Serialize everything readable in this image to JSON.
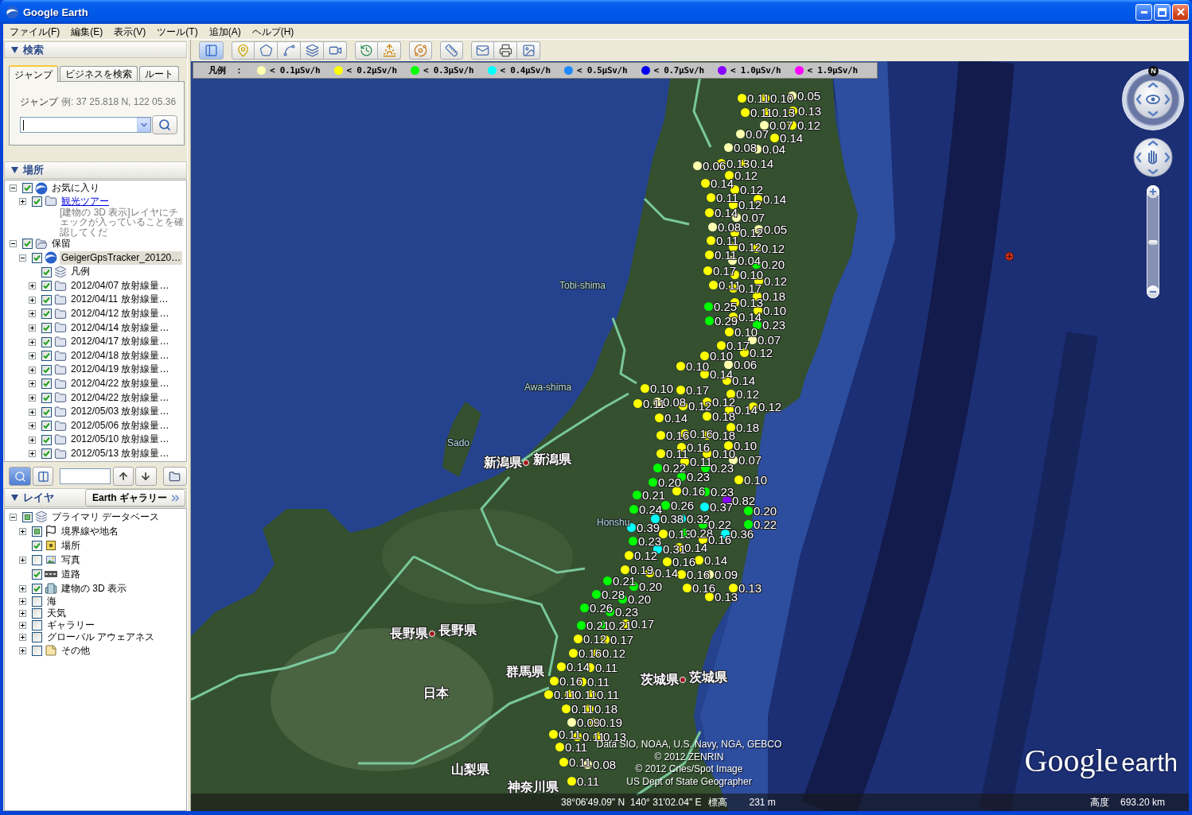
{
  "window": {
    "title": "Google Earth",
    "buttons": [
      {
        "kind": "minimize"
      },
      {
        "kind": "maximize"
      },
      {
        "kind": "close"
      }
    ]
  },
  "menu": [
    "ファイル(F)",
    "編集(E)",
    "表示(V)",
    "ツール(T)",
    "追加(A)",
    "ヘルプ(H)"
  ],
  "search": {
    "title": "検索",
    "expanded": true,
    "tabs": [
      {
        "label": "ジャンプ",
        "selected": true
      },
      {
        "label": "ビジネスを検索",
        "selected": false
      },
      {
        "label": "ルート",
        "selected": false
      }
    ],
    "hint_label": "ジャンプ",
    "hint_example": "例: 37 25.818 N, 122 05.36"
  },
  "places": {
    "title": "場所",
    "expanded": true,
    "items": [
      {
        "label": "お気に入り",
        "kind": "globe",
        "checked": true,
        "expanded": true,
        "selected": false,
        "children": [
          {
            "label": "観光ツアー",
            "kind": "folder",
            "checked": true,
            "expanded": false,
            "selected": false,
            "link": true,
            "description": "[建物の 3D 表示]レイヤにチェックが入っていることを確認してくだ"
          }
        ]
      },
      {
        "label": "保留",
        "kind": "folder-open",
        "checked": true,
        "expanded": true,
        "selected": false,
        "children": [
          {
            "label": "GeigerGpsTracker_20120…",
            "kind": "globe",
            "checked": true,
            "expanded": true,
            "selected": true,
            "children": [
              {
                "label": "凡例",
                "kind": "layers",
                "checked": true,
                "selected": false
              },
              {
                "label": "2012/04/07 放射線量…",
                "kind": "folder",
                "checked": true,
                "expanded": false,
                "selected": false
              },
              {
                "label": "2012/04/11 放射線量…",
                "kind": "folder",
                "checked": true,
                "expanded": false,
                "selected": false
              },
              {
                "label": "2012/04/12 放射線量…",
                "kind": "folder",
                "checked": true,
                "expanded": false,
                "selected": false
              },
              {
                "label": "2012/04/14 放射線量…",
                "kind": "folder",
                "checked": true,
                "expanded": false,
                "selected": false
              },
              {
                "label": "2012/04/17 放射線量…",
                "kind": "folder",
                "checked": true,
                "expanded": false,
                "selected": false
              },
              {
                "label": "2012/04/18 放射線量…",
                "kind": "folder",
                "checked": true,
                "expanded": false,
                "selected": false
              },
              {
                "label": "2012/04/19 放射線量…",
                "kind": "folder",
                "checked": true,
                "expanded": false,
                "selected": false
              },
              {
                "label": "2012/04/22 放射線量…",
                "kind": "folder",
                "checked": true,
                "expanded": false,
                "selected": false
              },
              {
                "label": "2012/04/22 放射線量…",
                "kind": "folder",
                "checked": true,
                "expanded": false,
                "selected": false
              },
              {
                "label": "2012/05/03 放射線量…",
                "kind": "folder",
                "checked": true,
                "expanded": false,
                "selected": false
              },
              {
                "label": "2012/05/06 放射線量…",
                "kind": "folder",
                "checked": true,
                "expanded": false,
                "selected": false
              },
              {
                "label": "2012/05/10 放射線量…",
                "kind": "folder",
                "checked": true,
                "expanded": false,
                "selected": false
              },
              {
                "label": "2012/05/13 放射線量…",
                "kind": "folder",
                "checked": true,
                "expanded": false,
                "selected": false
              }
            ]
          }
        ]
      }
    ]
  },
  "places_toolbar": [
    {
      "kind": "search",
      "selected": true
    },
    {
      "kind": "panel",
      "selected": false
    },
    {
      "kind": "field"
    },
    {
      "kind": "up"
    },
    {
      "kind": "down"
    },
    {
      "kind": "folder"
    }
  ],
  "layers": {
    "title": "レイヤ",
    "expanded": true,
    "gallery_button": "Earth ギャラリー",
    "items": [
      {
        "label": "プライマリ データベース",
        "kind": "layers",
        "checked": false,
        "mixed": true,
        "expanded": true,
        "children": [
          {
            "label": "境界線や地名",
            "kind": "flag",
            "checked": false,
            "mixed": true,
            "expanded": false
          },
          {
            "label": "場所",
            "kind": "place",
            "checked": true,
            "mixed": false
          },
          {
            "label": "写真",
            "kind": "photo",
            "checked": false,
            "mixed": false,
            "expanded": false
          },
          {
            "label": "道路",
            "kind": "road",
            "checked": true,
            "mixed": false
          },
          {
            "label": "建物の 3D 表示",
            "kind": "building",
            "checked": true,
            "mixed": false,
            "expanded": false
          },
          {
            "label": "海",
            "kind": "plain",
            "checked": false,
            "mixed": false,
            "expanded": false
          },
          {
            "label": "天気",
            "kind": "plain",
            "checked": false,
            "mixed": false,
            "expanded": false
          },
          {
            "label": "ギャラリー",
            "kind": "plain",
            "checked": false,
            "mixed": false,
            "expanded": false
          },
          {
            "label": "グローバル アウェアネス",
            "kind": "plain",
            "checked": false,
            "mixed": false,
            "expanded": false
          },
          {
            "label": "その他",
            "kind": "note",
            "checked": false,
            "mixed": false,
            "expanded": false
          }
        ]
      }
    ]
  },
  "toolbar": {
    "groups": [
      {
        "buttons": [
          {
            "kind": "sidebar",
            "selected": true
          }
        ]
      },
      {
        "buttons": [
          {
            "kind": "placemark",
            "selected": false
          },
          {
            "kind": "polygon",
            "selected": false
          },
          {
            "kind": "path",
            "selected": false
          },
          {
            "kind": "overlay",
            "selected": false
          },
          {
            "kind": "tour",
            "selected": false
          }
        ]
      },
      {
        "buttons": [
          {
            "kind": "history",
            "selected": false
          },
          {
            "kind": "sunlight",
            "selected": false
          }
        ]
      },
      {
        "buttons": [
          {
            "kind": "planet",
            "selected": false
          }
        ]
      },
      {
        "buttons": [
          {
            "kind": "ruler",
            "selected": false
          }
        ]
      },
      {
        "buttons": [
          {
            "kind": "email",
            "selected": false
          },
          {
            "kind": "print",
            "selected": false
          },
          {
            "kind": "image",
            "selected": false
          }
        ]
      }
    ]
  },
  "legend": {
    "title": "凡例　：",
    "items": [
      {
        "label": "< 0.1μSv/h",
        "color": "#ffffb0"
      },
      {
        "label": "< 0.2μSv/h",
        "color": "#ffff00"
      },
      {
        "label": "< 0.3μSv/h",
        "color": "#00ff00"
      },
      {
        "label": "< 0.4μSv/h",
        "color": "#00ffff"
      },
      {
        "label": "< 0.5μSv/h",
        "color": "#1e88ff"
      },
      {
        "label": "< 0.7μSv/h",
        "color": "#0000ee"
      },
      {
        "label": "< 1.0μSv/h",
        "color": "#8800ff"
      },
      {
        "label": "< 1.9μSv/h",
        "color": "#ff00ff"
      }
    ]
  },
  "map": {
    "labels": [
      {
        "text": "Tobi-shima",
        "kind": "island",
        "marker": false
      },
      {
        "text": "Awa-shima",
        "kind": "island",
        "marker": false
      },
      {
        "text": "Sado",
        "kind": "island",
        "marker": false
      },
      {
        "text": "新潟県",
        "kind": "prefecture",
        "marker": true
      },
      {
        "text": "新潟県",
        "kind": "prefecture",
        "marker": false
      },
      {
        "text": "Honshu",
        "kind": "region",
        "marker": false
      },
      {
        "text": "長野県",
        "kind": "prefecture",
        "marker": true
      },
      {
        "text": "長野県",
        "kind": "prefecture",
        "marker": false
      },
      {
        "text": "群馬県",
        "kind": "prefecture",
        "marker": false
      },
      {
        "text": "茨城県",
        "kind": "prefecture",
        "marker": true
      },
      {
        "text": "茨城県",
        "kind": "prefecture",
        "marker": false
      },
      {
        "text": "日本",
        "kind": "country",
        "marker": false
      },
      {
        "text": "山梨県",
        "kind": "prefecture",
        "marker": false
      },
      {
        "text": "神奈川県",
        "kind": "prefecture",
        "marker": false
      }
    ],
    "readings": [
      {
        "value": "0.11",
        "color": "#ffff00"
      },
      {
        "value": "0.10",
        "color": "#ffff00"
      },
      {
        "value": "0.05",
        "color": "#ffffb0"
      },
      {
        "value": "0.11",
        "color": "#ffff00"
      },
      {
        "value": "0.13",
        "color": "#ffff00"
      },
      {
        "value": "0.13",
        "color": "#ffff00"
      },
      {
        "value": "0.07",
        "color": "#ffffb0"
      },
      {
        "value": "0.12",
        "color": "#ffff00"
      },
      {
        "value": "0.07",
        "color": "#ffffb0"
      },
      {
        "value": "0.14",
        "color": "#ffff00"
      },
      {
        "value": "0.08",
        "color": "#ffffb0"
      },
      {
        "value": "0.04",
        "color": "#ffffb0"
      },
      {
        "value": "0.06",
        "color": "#ffffb0"
      },
      {
        "value": "0.13",
        "color": "#ffff00"
      },
      {
        "value": "0.14",
        "color": "#ffff00"
      },
      {
        "value": "0.12",
        "color": "#ffff00"
      },
      {
        "value": "0.14",
        "color": "#ffff00"
      },
      {
        "value": "0.12",
        "color": "#ffff00"
      },
      {
        "value": "0.11",
        "color": "#ffff00"
      },
      {
        "value": "0.12",
        "color": "#ffff00"
      },
      {
        "value": "0.14",
        "color": "#ffff00"
      },
      {
        "value": "0.14",
        "color": "#ffff00"
      },
      {
        "value": "0.07",
        "color": "#ffffb0"
      },
      {
        "value": "0.08",
        "color": "#ffffb0"
      },
      {
        "value": "0.12",
        "color": "#ffff00"
      },
      {
        "value": "0.05",
        "color": "#ffffb0"
      },
      {
        "value": "0.11",
        "color": "#ffff00"
      },
      {
        "value": "0.12",
        "color": "#ffff00"
      },
      {
        "value": "0.12",
        "color": "#ffff00"
      },
      {
        "value": "0.11",
        "color": "#ffff00"
      },
      {
        "value": "0.04",
        "color": "#ffffb0"
      },
      {
        "value": "0.20",
        "color": "#00ff00"
      },
      {
        "value": "0.17",
        "color": "#ffff00"
      },
      {
        "value": "0.10",
        "color": "#ffff00"
      },
      {
        "value": "0.11",
        "color": "#ffff00"
      },
      {
        "value": "0.17",
        "color": "#ffff00"
      },
      {
        "value": "0.12",
        "color": "#ffff00"
      },
      {
        "value": "0.18",
        "color": "#ffff00"
      },
      {
        "value": "0.25",
        "color": "#00ff00"
      },
      {
        "value": "0.13",
        "color": "#ffff00"
      },
      {
        "value": "0.10",
        "color": "#ffff00"
      },
      {
        "value": "0.29",
        "color": "#00ff00"
      },
      {
        "value": "0.14",
        "color": "#ffff00"
      },
      {
        "value": "0.23",
        "color": "#00ff00"
      },
      {
        "value": "0.10",
        "color": "#ffff00"
      },
      {
        "value": "0.07",
        "color": "#ffffb0"
      },
      {
        "value": "0.17",
        "color": "#ffff00"
      },
      {
        "value": "0.10",
        "color": "#ffff00"
      },
      {
        "value": "0.12",
        "color": "#ffff00"
      },
      {
        "value": "0.10",
        "color": "#ffff00"
      },
      {
        "value": "0.06",
        "color": "#ffffb0"
      },
      {
        "value": "0.14",
        "color": "#ffff00"
      },
      {
        "value": "0.14",
        "color": "#ffff00"
      },
      {
        "value": "0.10",
        "color": "#ffff00"
      },
      {
        "value": "0.17",
        "color": "#ffff00"
      },
      {
        "value": "0.12",
        "color": "#ffff00"
      },
      {
        "value": "0.11",
        "color": "#ffff00"
      },
      {
        "value": "0.08",
        "color": "#ffffb0"
      },
      {
        "value": "0.12",
        "color": "#ffff00"
      },
      {
        "value": "0.12",
        "color": "#ffff00"
      },
      {
        "value": "0.14",
        "color": "#ffff00"
      },
      {
        "value": "0.12",
        "color": "#ffff00"
      },
      {
        "value": "0.14",
        "color": "#ffff00"
      },
      {
        "value": "0.18",
        "color": "#ffff00"
      },
      {
        "value": "0.18",
        "color": "#ffff00"
      },
      {
        "value": "0.16",
        "color": "#ffff00"
      },
      {
        "value": "0.16",
        "color": "#ffff00"
      },
      {
        "value": "0.18",
        "color": "#ffff00"
      },
      {
        "value": "0.16",
        "color": "#ffff00"
      },
      {
        "value": "0.10",
        "color": "#ffff00"
      },
      {
        "value": "0.11",
        "color": "#ffff00"
      },
      {
        "value": "0.10",
        "color": "#ffff00"
      },
      {
        "value": "0.11",
        "color": "#ffff00"
      },
      {
        "value": "0.07",
        "color": "#ffffb0"
      },
      {
        "value": "0.22",
        "color": "#00ff00"
      },
      {
        "value": "0.23",
        "color": "#00ff00"
      },
      {
        "value": "0.20",
        "color": "#00ff00"
      },
      {
        "value": "0.23",
        "color": "#00ff00"
      },
      {
        "value": "0.10",
        "color": "#ffff00"
      },
      {
        "value": "0.21",
        "color": "#00ff00"
      },
      {
        "value": "0.16",
        "color": "#ffff00"
      },
      {
        "value": "0.23",
        "color": "#00ff00"
      },
      {
        "value": "0.24",
        "color": "#00ff00"
      },
      {
        "value": "0.26",
        "color": "#00ff00"
      },
      {
        "value": "0.37",
        "color": "#00ffff"
      },
      {
        "value": "0.82",
        "color": "#8800ff"
      },
      {
        "value": "0.20",
        "color": "#00ff00"
      },
      {
        "value": "0.39",
        "color": "#00ffff"
      },
      {
        "value": "0.38",
        "color": "#00ffff"
      },
      {
        "value": "0.32",
        "color": "#00ffff"
      },
      {
        "value": "0.22",
        "color": "#00ff00"
      },
      {
        "value": "0.22",
        "color": "#00ff00"
      },
      {
        "value": "0.13",
        "color": "#ffff00"
      },
      {
        "value": "0.28",
        "color": "#00ff00"
      },
      {
        "value": "0.36",
        "color": "#00ffff"
      },
      {
        "value": "0.23",
        "color": "#00ff00"
      },
      {
        "value": "0.16",
        "color": "#ffff00"
      },
      {
        "value": "0.31",
        "color": "#00ffff"
      },
      {
        "value": "0.14",
        "color": "#ffff00"
      },
      {
        "value": "0.12",
        "color": "#ffff00"
      },
      {
        "value": "0.16",
        "color": "#ffff00"
      },
      {
        "value": "0.14",
        "color": "#ffff00"
      },
      {
        "value": "0.19",
        "color": "#ffff00"
      },
      {
        "value": "0.14",
        "color": "#ffff00"
      },
      {
        "value": "0.16",
        "color": "#ffff00"
      },
      {
        "value": "0.09",
        "color": "#ffffb0"
      },
      {
        "value": "0.21",
        "color": "#00ff00"
      },
      {
        "value": "0.20",
        "color": "#00ff00"
      },
      {
        "value": "0.16",
        "color": "#ffff00"
      },
      {
        "value": "0.13",
        "color": "#ffff00"
      },
      {
        "value": "0.28",
        "color": "#00ff00"
      },
      {
        "value": "0.20",
        "color": "#00ff00"
      },
      {
        "value": "0.13",
        "color": "#ffff00"
      },
      {
        "value": "0.26",
        "color": "#00ff00"
      },
      {
        "value": "0.23",
        "color": "#00ff00"
      },
      {
        "value": "0.21",
        "color": "#00ff00"
      },
      {
        "value": "0.21",
        "color": "#00ff00"
      },
      {
        "value": "0.17",
        "color": "#ffff00"
      },
      {
        "value": "0.12",
        "color": "#ffff00"
      },
      {
        "value": "0.17",
        "color": "#ffff00"
      },
      {
        "value": "0.16",
        "color": "#ffff00"
      },
      {
        "value": "0.12",
        "color": "#ffff00"
      },
      {
        "value": "0.14",
        "color": "#ffff00"
      },
      {
        "value": "0.11",
        "color": "#ffff00"
      },
      {
        "value": "0.16",
        "color": "#ffff00"
      },
      {
        "value": "0.11",
        "color": "#ffff00"
      },
      {
        "value": "0.11",
        "color": "#ffff00"
      },
      {
        "value": "0.11",
        "color": "#ffff00"
      },
      {
        "value": "0.11",
        "color": "#ffff00"
      },
      {
        "value": "0.11",
        "color": "#ffff00"
      },
      {
        "value": "0.18",
        "color": "#ffff00"
      },
      {
        "value": "0.09",
        "color": "#ffffb0"
      },
      {
        "value": "0.19",
        "color": "#ffff00"
      },
      {
        "value": "0.11",
        "color": "#ffff00"
      },
      {
        "value": "0.11",
        "color": "#ffff00"
      },
      {
        "value": "0.13",
        "color": "#ffff00"
      },
      {
        "value": "0.11",
        "color": "#ffff00"
      },
      {
        "value": "0.11",
        "color": "#ffff00"
      },
      {
        "value": "0.08",
        "color": "#ffffb0"
      },
      {
        "value": "0.11",
        "color": "#ffff00"
      }
    ],
    "attribution": [
      "Data SIO, NOAA, U.S. Navy, NGA, GEBCO",
      "© 2012 ZENRIN",
      "© 2012 Cnes/Spot Image",
      "US Dept of State Geographer"
    ],
    "logo": {
      "brand": "Google",
      "product": "earth"
    }
  },
  "navigation": {
    "north": "N",
    "zoom": {
      "level": 0.5
    }
  },
  "status_bar": {
    "latitude": "38°06'49.09\" N",
    "longitude": "140° 31'02.04\" E",
    "elevation_label": "標高",
    "elevation": "231 m",
    "altitude_label": "高度",
    "altitude": "693.20 km"
  }
}
